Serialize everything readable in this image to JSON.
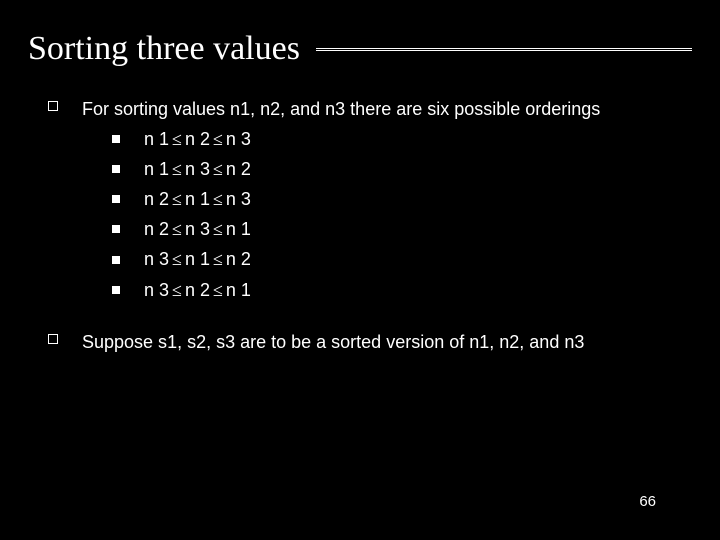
{
  "title": "Sorting three values",
  "para1_a": "For sorting values n",
  "para1_b": "1, n",
  "para1_c": "2, and n",
  "para1_d": "3 there are six possible orderings",
  "orderings": [
    {
      "a": "n",
      "b": "1",
      "c": "n",
      "d": "2",
      "e": "n",
      "f": "3"
    },
    {
      "a": "n",
      "b": "1",
      "c": "n",
      "d": "3",
      "e": "n",
      "f": "2"
    },
    {
      "a": "n",
      "b": "2",
      "c": "n",
      "d": "1",
      "e": "n",
      "f": "3"
    },
    {
      "a": "n",
      "b": "2",
      "c": "n",
      "d": "3",
      "e": "n",
      "f": "1"
    },
    {
      "a": "n",
      "b": "3",
      "c": "n",
      "d": "1",
      "e": "n",
      "f": "2"
    },
    {
      "a": "n",
      "b": "3",
      "c": "n",
      "d": "2",
      "e": "n",
      "f": "1"
    }
  ],
  "le_sym": "≤",
  "para2_a": "Suppose s",
  "para2_b": "1, s",
  "para2_c": "2, s",
  "para2_d": "3 are to be a sorted version of n",
  "para2_e": "1, n",
  "para2_f": "2, and n",
  "para2_g": "3",
  "page_number": "66"
}
